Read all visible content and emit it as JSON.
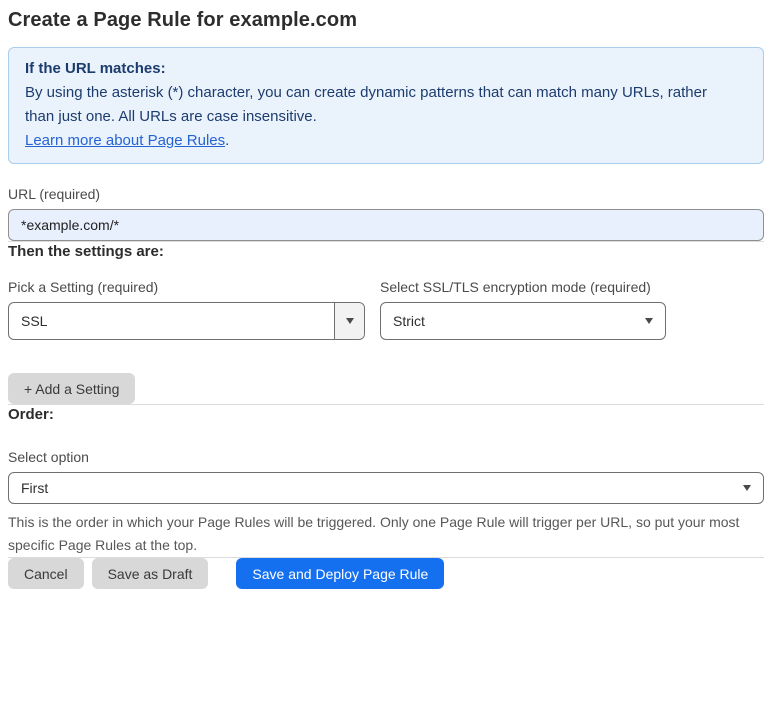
{
  "page": {
    "title": "Create a Page Rule for example.com"
  },
  "info_box": {
    "heading": "If the URL matches:",
    "body": "By using the asterisk (*) character, you can create dynamic patterns that can match many URLs, rather than just one. All URLs are case insensitive.",
    "link_label": "Learn more about Page Rules",
    "link_suffix": "."
  },
  "url_field": {
    "label": "URL (required)",
    "value": "*example.com/*"
  },
  "settings_section": {
    "heading": "Then the settings are:",
    "setting_select": {
      "label": "Pick a Setting (required)",
      "value": "SSL"
    },
    "mode_select": {
      "label": "Select SSL/TLS encryption mode (required)",
      "value": "Strict"
    },
    "add_setting_label": "+ Add a Setting"
  },
  "order_section": {
    "heading": "Order:",
    "select_label": "Select option",
    "select_value": "First",
    "help_text": "This is the order in which your Page Rules will be triggered. Only one Page Rule will trigger per URL, so put your most specific Page Rules at the top."
  },
  "actions": {
    "cancel_label": "Cancel",
    "save_draft_label": "Save as Draft",
    "save_deploy_label": "Save and Deploy Page Rule"
  },
  "icons": {
    "caret_down_icon": "▾"
  },
  "colors": {
    "accent": "#1570f0",
    "info-bg": "#eaf3fc",
    "info-border": "#abcdec",
    "info-text": "#1d3c6e",
    "link": "#2563d4",
    "input-bg": "#e8f0fe",
    "divider": "#dcdcdc",
    "btn-gray": "#d8d8d8",
    "border-gray": "#6f6f6f"
  }
}
